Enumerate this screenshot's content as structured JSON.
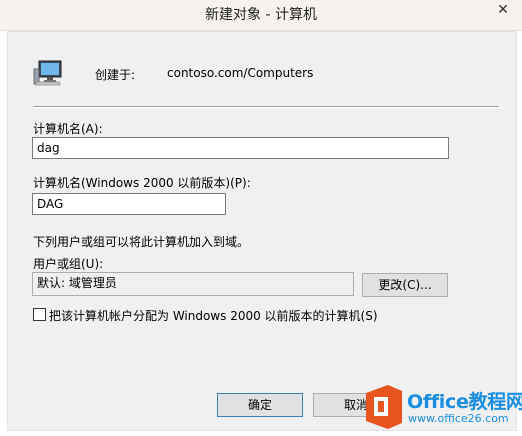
{
  "window": {
    "title": "新建对象 - 计算机",
    "close_glyph": "✕"
  },
  "header": {
    "icon": "computer-icon",
    "created_in_label": "创建于:",
    "created_in_value": "contoso.com/Computers"
  },
  "form": {
    "computer_name_label": "计算机名(A):",
    "computer_name_value": "dag",
    "pre2000_name_label": "计算机名(Windows 2000 以前版本)(P):",
    "pre2000_name_value": "DAG",
    "join_info_text": "下列用户或组可以将此计算机加入到域。",
    "user_group_label": "用户或组(U):",
    "user_group_value": "默认: 域管理员",
    "change_button": "更改(C)...",
    "assign_checkbox_label": "把该计算机帐户分配为 Windows 2000 以前版本的计算机(S)",
    "assign_checkbox_checked": false
  },
  "buttons": {
    "ok": "确定",
    "cancel": "取消"
  },
  "watermark": {
    "brand": "Office教程网",
    "url": "www.office26.com",
    "colors": {
      "blue": "#1a8ee1",
      "orange": "#e8541e"
    }
  }
}
